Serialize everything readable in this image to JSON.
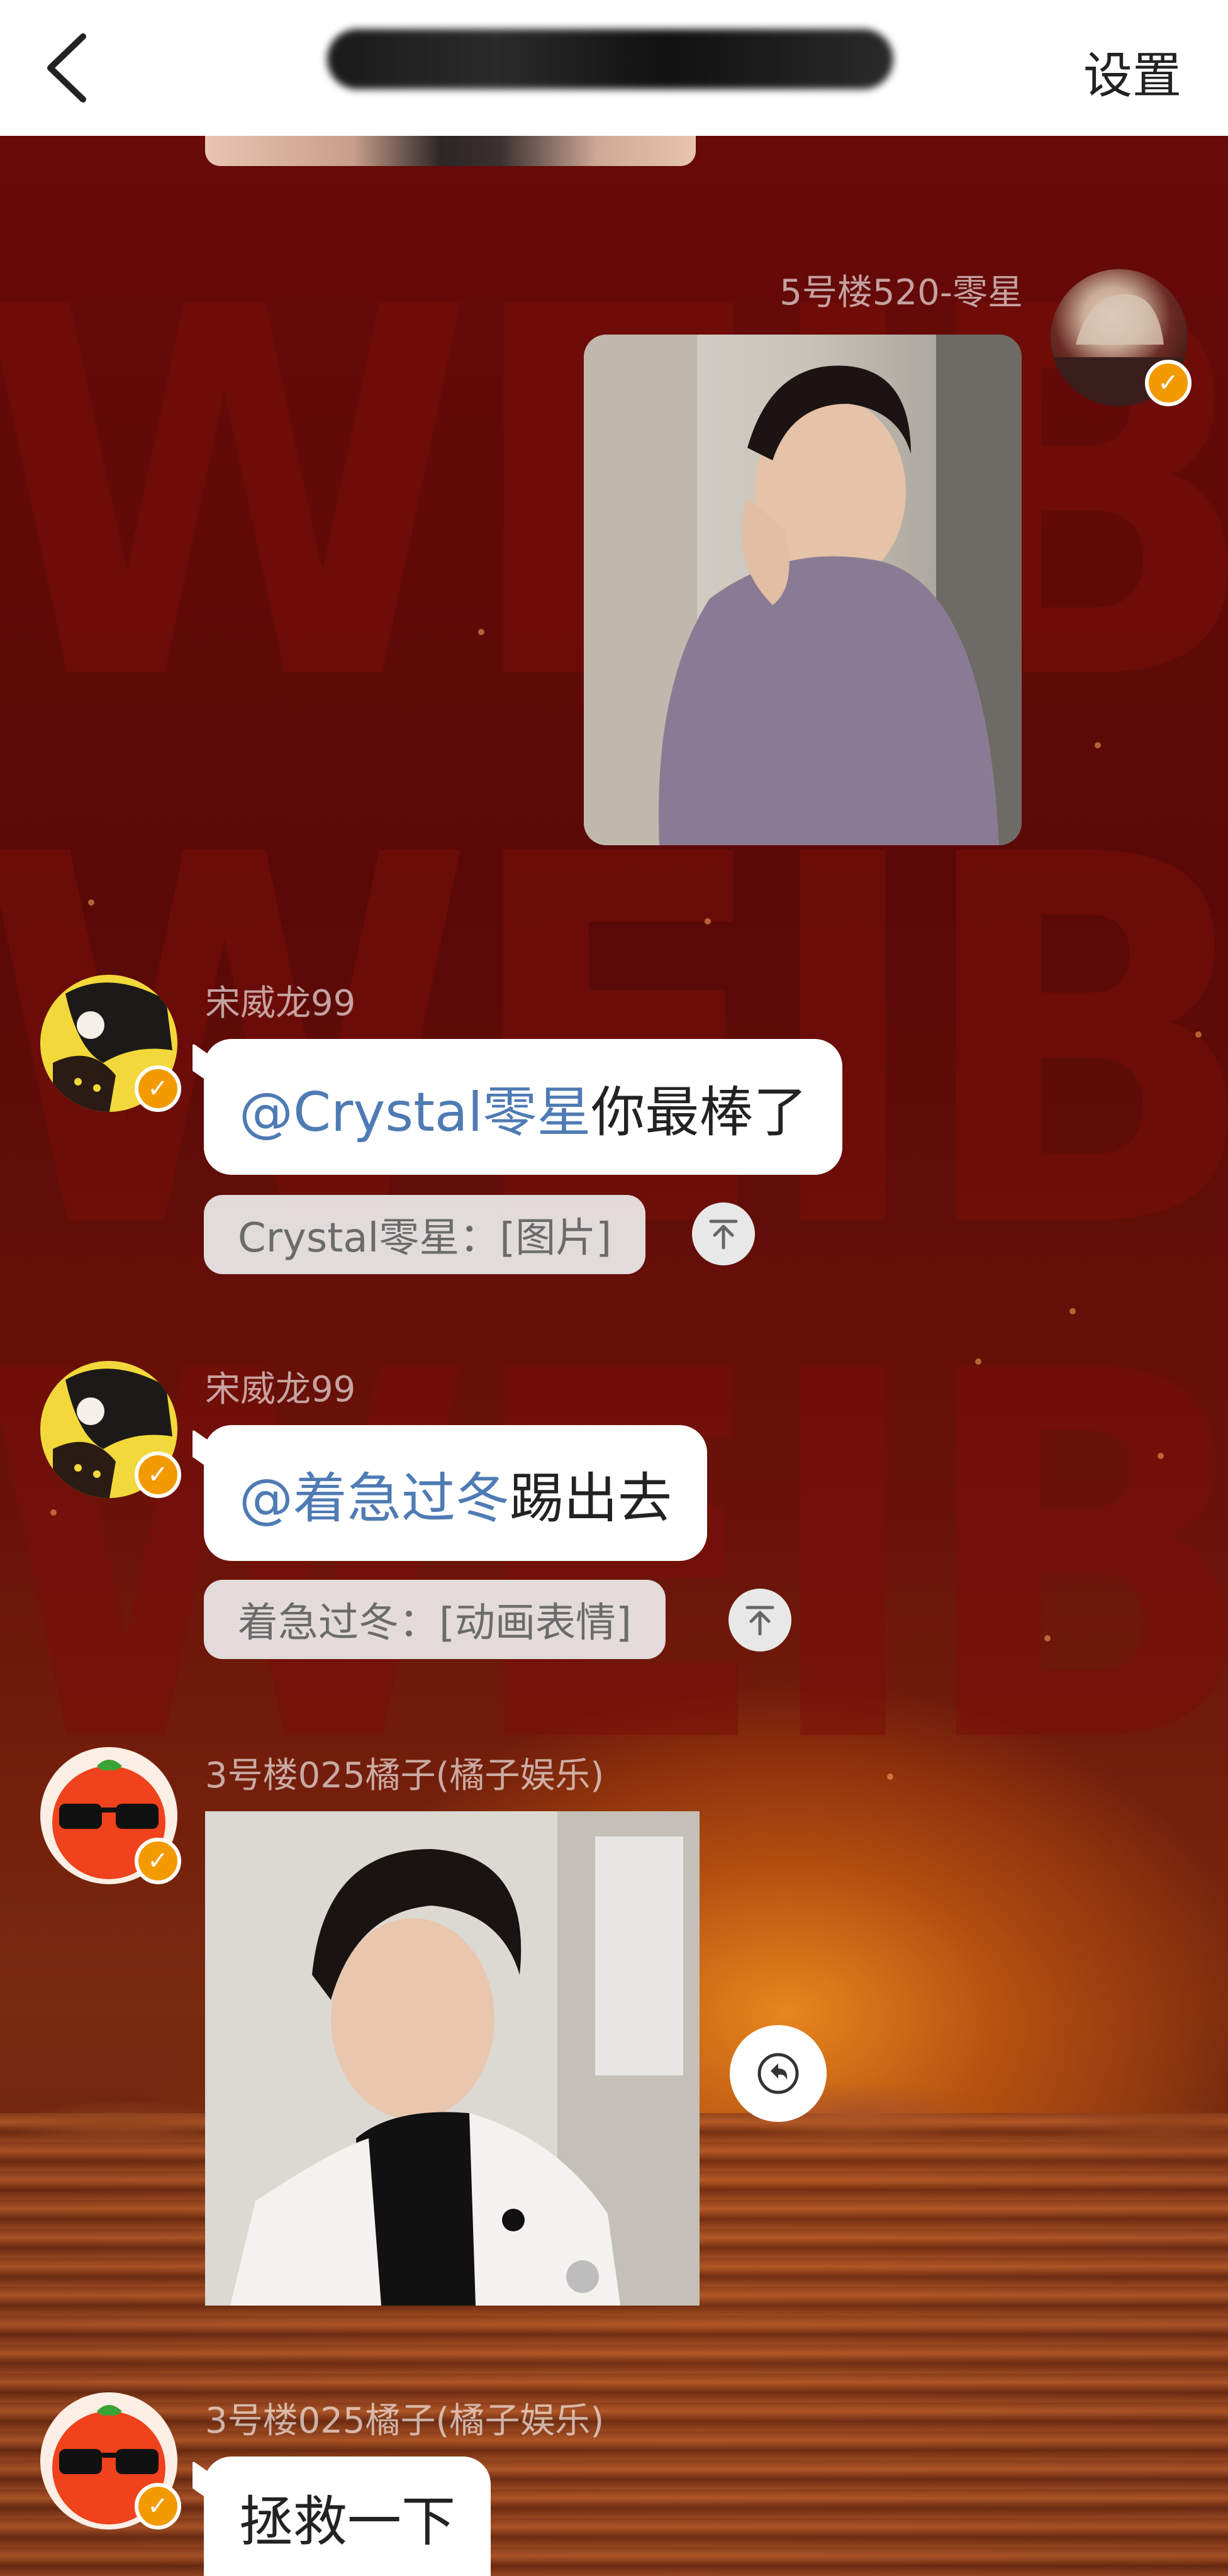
{
  "header": {
    "back_icon": "chevron-left-icon",
    "title": "",
    "settings_label": "设置"
  },
  "watermark": [
    "WEIBO",
    "WEIBO",
    "WEIBO"
  ],
  "messages": [
    {
      "sender": "5号楼520-零星",
      "type": "image",
      "avatar_icon": "user-avatar-icon",
      "verified_icon": "v-badge-icon"
    },
    {
      "sender": "宋威龙99",
      "mention": "@Crystal零星",
      "text": " 你最棒了",
      "quote": "Crystal零星：[图片]",
      "quote_icon": "arrow-up-to-top-icon"
    },
    {
      "sender": "宋威龙99",
      "mention": "@着急过冬",
      "text": " 踢出去",
      "quote": "着急过冬：[动画表情]",
      "quote_icon": "arrow-up-to-top-icon"
    },
    {
      "sender": "3号楼025橘子(橘子娱乐)",
      "type": "image",
      "reply_icon": "undo-reply-icon"
    },
    {
      "sender": "3号楼025橘子(橘子娱乐)",
      "text": "拯救一下"
    }
  ],
  "colors": {
    "mention": "#4f7bb4",
    "badge": "#f39a00",
    "bubble": "#ffffff"
  }
}
